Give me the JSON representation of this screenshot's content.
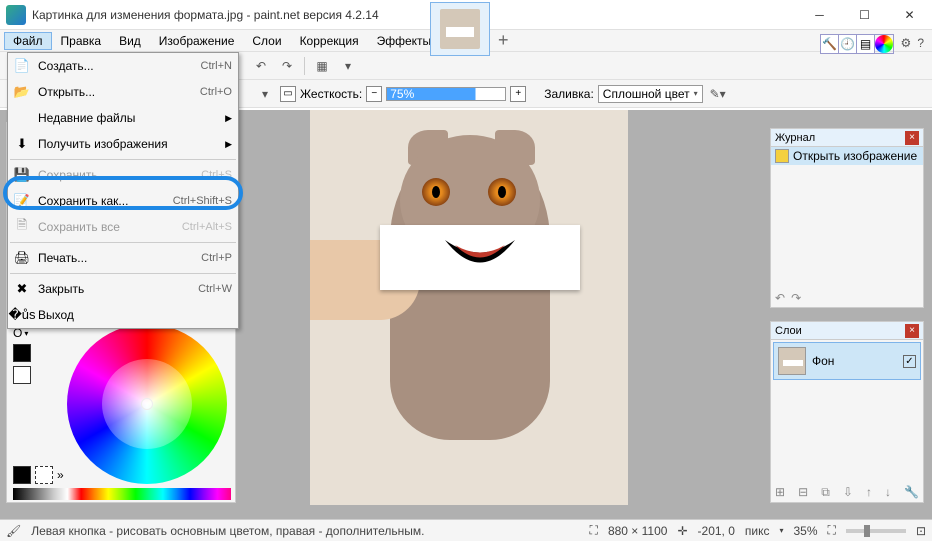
{
  "window": {
    "title": "Картинка для изменения формата.jpg - paint.net версия 4.2.14"
  },
  "menubar": [
    "Файл",
    "Правка",
    "Вид",
    "Изображение",
    "Слои",
    "Коррекция",
    "Эффекты"
  ],
  "toolbar2": {
    "hardness_label": "Жесткость:",
    "hardness_value": "75%",
    "fill_label": "Заливка:",
    "fill_value": "Сплошной цвет"
  },
  "file_menu": [
    {
      "icon": "new",
      "label": "Создать...",
      "shortcut": "Ctrl+N",
      "disabled": false
    },
    {
      "icon": "open",
      "label": "Открыть...",
      "shortcut": "Ctrl+O",
      "disabled": false
    },
    {
      "icon": "",
      "label": "Недавние файлы",
      "shortcut": "",
      "sub": true,
      "disabled": false
    },
    {
      "icon": "acq",
      "label": "Получить изображения",
      "shortcut": "",
      "sub": true,
      "disabled": false
    },
    {
      "sep": true
    },
    {
      "icon": "save",
      "label": "Сохранить",
      "shortcut": "Ctrl+S",
      "disabled": true
    },
    {
      "icon": "saveas",
      "label": "Сохранить как...",
      "shortcut": "Ctrl+Shift+S",
      "disabled": false,
      "hi": true
    },
    {
      "icon": "saveall",
      "label": "Сохранить все",
      "shortcut": "Ctrl+Alt+S",
      "disabled": true
    },
    {
      "sep": true
    },
    {
      "icon": "print",
      "label": "Печать...",
      "shortcut": "Ctrl+P",
      "disabled": false
    },
    {
      "sep": true
    },
    {
      "icon": "close",
      "label": "Закрыть",
      "shortcut": "Ctrl+W",
      "disabled": false
    },
    {
      "icon": "exit",
      "label": "Выход",
      "shortcut": "",
      "disabled": false
    }
  ],
  "history": {
    "title": "Журнал",
    "item": "Открыть изображение"
  },
  "layers": {
    "title": "Слои",
    "item": "Фон"
  },
  "status": {
    "hint": "Левая кнопка - рисовать основным цветом, правая - дополнительным.",
    "dims": "880 × 1100",
    "pos": "-201, 0",
    "unit": "пикс",
    "zoom": "35%"
  },
  "colors_panel": {
    "primary": "#000000",
    "secondary": "#ffffff"
  }
}
